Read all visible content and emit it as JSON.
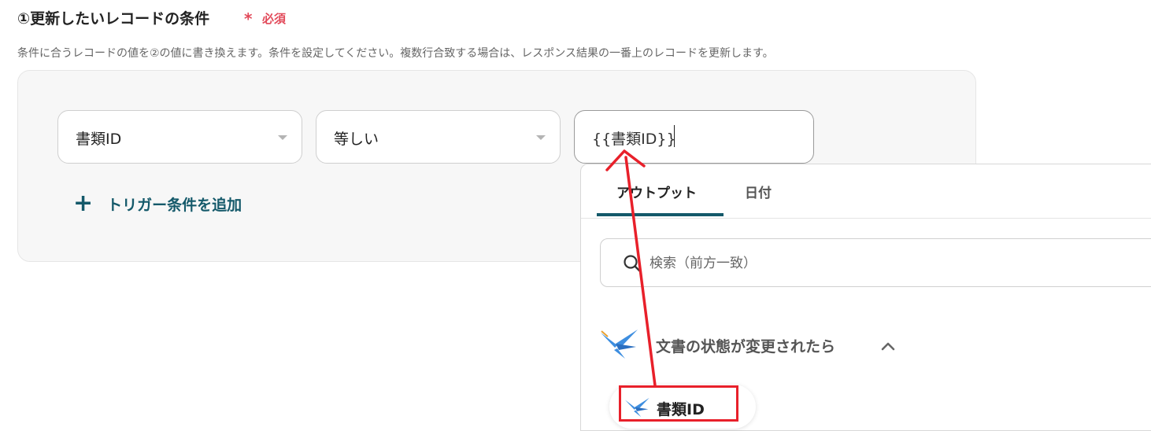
{
  "section": {
    "title": "①更新したいレコードの条件",
    "required_mark": "*",
    "required_label": "必須",
    "description": "条件に合うレコードの値を②の値に書き換えます。条件を設定してください。複数行合致する場合は、レスポンス結果の一番上のレコードを更新します。"
  },
  "condition": {
    "field_select": "書類ID",
    "operator_select": "等しい",
    "value_input": "{{書類ID}}"
  },
  "add_button": {
    "icon": "plus-icon",
    "label": "トリガー条件を追加"
  },
  "dropdown": {
    "tabs": [
      {
        "label": "アウトプット",
        "active": true
      },
      {
        "label": "日付",
        "active": false
      }
    ],
    "search_placeholder": "検索（前方一致）",
    "group": {
      "icon": "swallow-app-icon",
      "label": "文書の状態が変更されたら",
      "expanded": true
    },
    "items": [
      {
        "icon": "swallow-app-icon",
        "label": "書類ID"
      }
    ]
  },
  "colors": {
    "accent": "#14596a",
    "required": "#e24a5a",
    "annotation": "#e8202a",
    "app_icon": "#3d8ee0"
  }
}
